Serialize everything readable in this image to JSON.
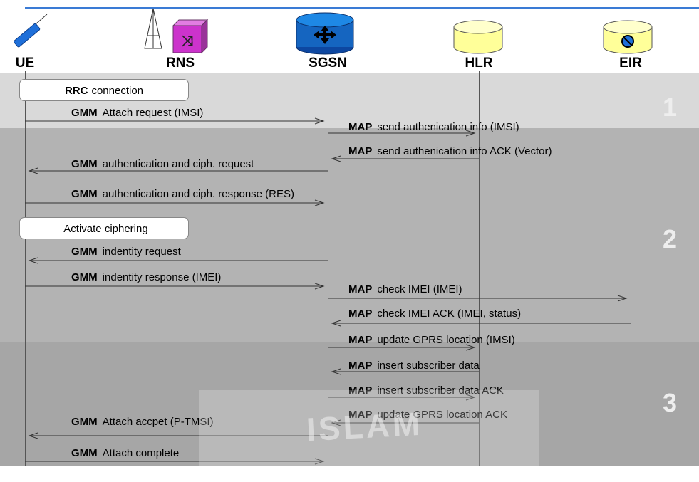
{
  "entities": [
    {
      "id": "ue",
      "label": "UE",
      "icon": "antenna-icon"
    },
    {
      "id": "rns",
      "label": "RNS",
      "icon": "radio-tower-switch-icon"
    },
    {
      "id": "sgsn",
      "label": "SGSN",
      "icon": "router-cylinder-icon"
    },
    {
      "id": "hlr",
      "label": "HLR",
      "icon": "database-cylinder-icon"
    },
    {
      "id": "eir",
      "label": "EIR",
      "icon": "no-entry-cylinder-icon"
    }
  ],
  "phases": [
    {
      "number": "1"
    },
    {
      "number": "2"
    },
    {
      "number": "3"
    }
  ],
  "boxes": [
    {
      "protocol": "RRC",
      "text": "connection"
    },
    {
      "protocol": "",
      "text": "Activate ciphering"
    }
  ],
  "messages": [
    {
      "protocol": "GMM",
      "text": "Attach request (IMSI)",
      "from": "UE",
      "to": "SGSN"
    },
    {
      "protocol": "MAP",
      "text": "send authenication info (IMSI)",
      "from": "SGSN",
      "to": "HLR"
    },
    {
      "protocol": "MAP",
      "text": "send authenication info ACK (Vector)",
      "from": "HLR",
      "to": "SGSN"
    },
    {
      "protocol": "GMM",
      "text": "authentication and ciph. request",
      "from": "SGSN",
      "to": "UE"
    },
    {
      "protocol": "GMM",
      "text": "authentication and ciph. response (RES)",
      "from": "UE",
      "to": "SGSN"
    },
    {
      "protocol": "GMM",
      "text": "indentity request",
      "from": "SGSN",
      "to": "UE"
    },
    {
      "protocol": "GMM",
      "text": "indentity response (IMEI)",
      "from": "UE",
      "to": "SGSN"
    },
    {
      "protocol": "MAP",
      "text": "check IMEI (IMEI)",
      "from": "SGSN",
      "to": "EIR"
    },
    {
      "protocol": "MAP",
      "text": "check IMEI ACK (IMEI, status)",
      "from": "EIR",
      "to": "SGSN"
    },
    {
      "protocol": "MAP",
      "text": "update GPRS location (IMSI)",
      "from": "SGSN",
      "to": "HLR"
    },
    {
      "protocol": "MAP",
      "text": "insert subscriber data",
      "from": "HLR",
      "to": "SGSN"
    },
    {
      "protocol": "MAP",
      "text": "insert subscriber data ACK",
      "from": "SGSN",
      "to": "HLR"
    },
    {
      "protocol": "MAP",
      "text": "update GPRS location ACK",
      "from": "HLR",
      "to": "SGSN"
    },
    {
      "protocol": "GMM",
      "text": "Attach accpet (P-TMSI)",
      "from": "SGSN",
      "to": "UE"
    },
    {
      "protocol": "GMM",
      "text": "Attach complete",
      "from": "UE",
      "to": "SGSN"
    }
  ],
  "watermark": {
    "text": "ISLAM"
  },
  "colors": {
    "top_rule": "#3a7bd5",
    "sgsn_fill": "#1565c0",
    "hlr_fill": "#ffff99",
    "eir_fill": "#ffff99",
    "rns_fill": "#cc33cc",
    "ue_fill": "#1e6fd9"
  }
}
